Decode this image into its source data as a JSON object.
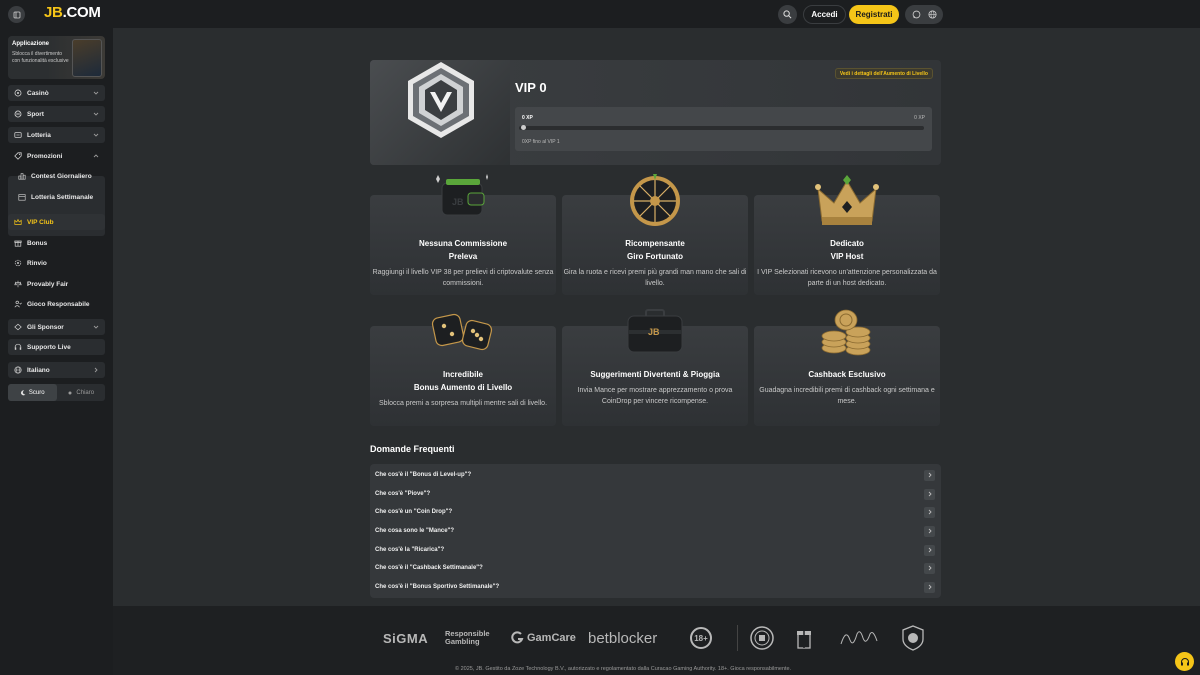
{
  "header": {
    "logo_primary": "JB",
    "logo_secondary": ".COM",
    "login_label": "Accedi",
    "register_label": "Registrati"
  },
  "sidebar": {
    "app_card": {
      "title": "Applicazione",
      "subtitle": "Sblocca il divertimento con funzionalità esclusive"
    },
    "items": [
      {
        "label": "Casinò",
        "icon": "casino-icon"
      },
      {
        "label": "Sport",
        "icon": "sport-icon"
      },
      {
        "label": "Lotteria",
        "icon": "lottery-icon"
      },
      {
        "label": "Promozioni",
        "icon": "promotions-icon"
      },
      {
        "label": "Contest Giornaliero",
        "icon": "contest-icon"
      },
      {
        "label": "Lotteria Settimanale",
        "icon": "weekly-lottery-icon"
      },
      {
        "label": "VIP Club",
        "icon": "crown-icon"
      },
      {
        "label": "Bonus",
        "icon": "gift-icon"
      },
      {
        "label": "Rinvio",
        "icon": "rebate-icon"
      },
      {
        "label": "Provably Fair",
        "icon": "fair-icon"
      },
      {
        "label": "Gioco Responsabile",
        "icon": "responsible-icon"
      },
      {
        "label": "Gli Sponsor",
        "icon": "sponsor-icon"
      },
      {
        "label": "Supporto Live",
        "icon": "headset-icon"
      },
      {
        "label": "Italiano",
        "icon": "globe-icon"
      }
    ],
    "theme": {
      "dark_label": "Scuro",
      "light_label": "Chiaro"
    }
  },
  "vip": {
    "title": "VIP 0",
    "details_label": "Vedi i dettagli dell'Aumento di Livello",
    "xp_current": "0 XP",
    "xp_target": "0 XP",
    "progress_fraction": 0,
    "note": "0XP fino al VIP 1"
  },
  "features": [
    {
      "title_1": "Nessuna Commissione",
      "title_2": "Preleva",
      "desc": "Raggiungi il livello VIP 38 per prelievi di criptovalute senza commissioni."
    },
    {
      "title_1": "Ricompensante",
      "title_2": "Giro Fortunato",
      "desc": "Gira la ruota e ricevi premi più grandi man mano che sali di livello."
    },
    {
      "title_1": "Dedicato",
      "title_2": "VIP Host",
      "desc": "I VIP Selezionati ricevono un'attenzione personalizzata da parte di un host dedicato."
    },
    {
      "title_1": "Incredibile",
      "title_2": "Bonus Aumento di Livello",
      "desc": "Sblocca premi a sorpresa multipli mentre sali di livello."
    },
    {
      "title_1": "Suggerimenti Divertenti & Pioggia",
      "title_2": "",
      "desc": "Invia Mance per mostrare apprezzamento o prova CoinDrop per vincere ricompense."
    },
    {
      "title_1": "Cashback Esclusivo",
      "title_2": "",
      "desc": "Guadagna incredibili premi di cashback ogni settimana e mese."
    }
  ],
  "faq": {
    "heading": "Domande Frequenti",
    "items": [
      "Che cos'è il \"Bonus di Level-up\"?",
      "Che cos'è \"Piove\"?",
      "Che cos'è un \"Coin Drop\"?",
      "Che cosa sono le \"Mance\"?",
      "Che cos'è la \"Ricarica\"?",
      "Che cos'è il \"Cashback Settimanale\"?",
      "Che cos'è il \"Bonus Sportivo Settimanale\"?"
    ]
  },
  "footer": {
    "logos": [
      "SiGMA",
      "Responsible",
      "Gambling",
      "GamCare",
      "betblocker",
      "18+"
    ],
    "copyright": "© 2025, JB. Gestito da Zoze Technology B.V., autorizzato e regolamentato dalla Curacao Gaming Authority. 18+. Gioca responsabilmente."
  }
}
